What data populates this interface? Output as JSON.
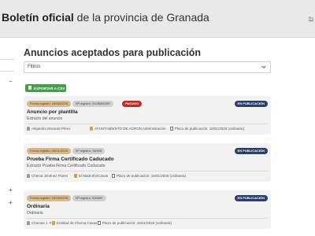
{
  "header": {
    "title_bold": "Boletín oficial",
    "title_rest": " de la provincia de Granada",
    "link": "Bu"
  },
  "sidebar": {
    "toggles": [
      "−",
      "+",
      "+"
    ]
  },
  "main": {
    "title": "Anuncios aceptados para publicación",
    "filter": {
      "label": "Filtros"
    },
    "export_label": "EXPORTAR A CSV",
    "cards": [
      {
        "date": "Fecha registro: 15/06/2025",
        "registry": "Nº registro: 2025M00057",
        "paid": "PAGADO",
        "state": "EN PUBLICACIÓN",
        "title": "Anuncio por plantilla",
        "subtitle": "Extracto del anuncio",
        "person": "Alejandro Morante Pérez",
        "org": "AYUNTAMIENTO DE AGRON Administración",
        "plazo": "Plazo de publicación: 15/01/2026 (ordinaria)"
      },
      {
        "date": "Fecha registro: 29/01/2026",
        "registry": "Nº registro: 76/090",
        "state": "EN PUBLICACIÓN",
        "title": "Prueba Firma Certificado Caducado",
        "subtitle": "Extracto Prueba Firma Certificado Caducado",
        "person": "Chema Jiménez Flores",
        "org": "El Madroño/Casas",
        "plazo": "Plazo de publicación: 15/01/2026 (ordinaria)"
      },
      {
        "date": "Fecha registro: 03/06/2025",
        "registry": "Nº registro: 93680F",
        "state": "EN PUBLICACIÓN",
        "title": "Ordinaria",
        "subtitle": "Ordinaria",
        "person": "Chemas J. F.",
        "org": "Entidad de Chema Casas",
        "plazo": "Plazo de publicación: 15/01/2026 (ordinaria)"
      }
    ]
  },
  "colors": {
    "header_bg": "#e9e9e9",
    "export_green": "#43a047",
    "paid_red": "#c62828",
    "state_navy": "#2b3f6b",
    "date_chip": "#d8b88a",
    "card_bg": "#f2f2f2"
  },
  "icons": {
    "chevron": "chevron-down-icon",
    "export": "file-icon",
    "person": "person-icon",
    "folder": "folder-icon",
    "calendar": "calendar-icon"
  }
}
